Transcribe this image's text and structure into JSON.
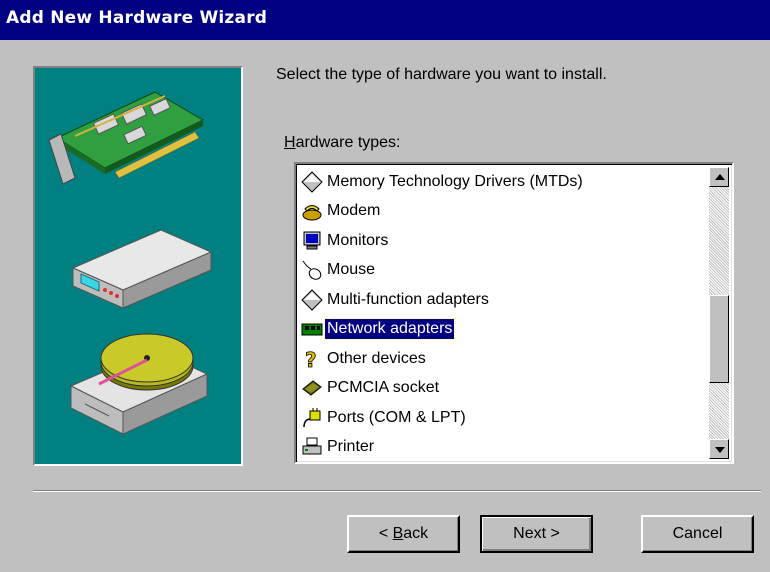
{
  "window": {
    "title": "Add New Hardware Wizard"
  },
  "instruction": "Select the type of hardware you want to install.",
  "list": {
    "label_mnemonic": "H",
    "label_rest": "ardware types:",
    "items": [
      {
        "label": "Memory Technology Drivers (MTDs)",
        "icon": "diamond-icon"
      },
      {
        "label": "Modem",
        "icon": "modem-icon"
      },
      {
        "label": "Monitors",
        "icon": "monitor-icon"
      },
      {
        "label": "Mouse",
        "icon": "mouse-icon"
      },
      {
        "label": "Multi-function adapters",
        "icon": "diamond-icon"
      },
      {
        "label": "Network adapters",
        "icon": "network-card-icon",
        "selected": true
      },
      {
        "label": "Other devices",
        "icon": "question-mark-icon"
      },
      {
        "label": "PCMCIA socket",
        "icon": "pcmcia-card-icon"
      },
      {
        "label": "Ports (COM & LPT)",
        "icon": "port-connector-icon"
      },
      {
        "label": "Printer",
        "icon": "printer-icon"
      }
    ]
  },
  "buttons": {
    "back_prefix": "< ",
    "back_mnemonic": "B",
    "back_rest": "ack",
    "next": "Next >",
    "cancel": "Cancel"
  },
  "colors": {
    "titlebar": "#000080",
    "panel": "#008080",
    "face": "#c0c0c0",
    "selection": "#000080"
  }
}
